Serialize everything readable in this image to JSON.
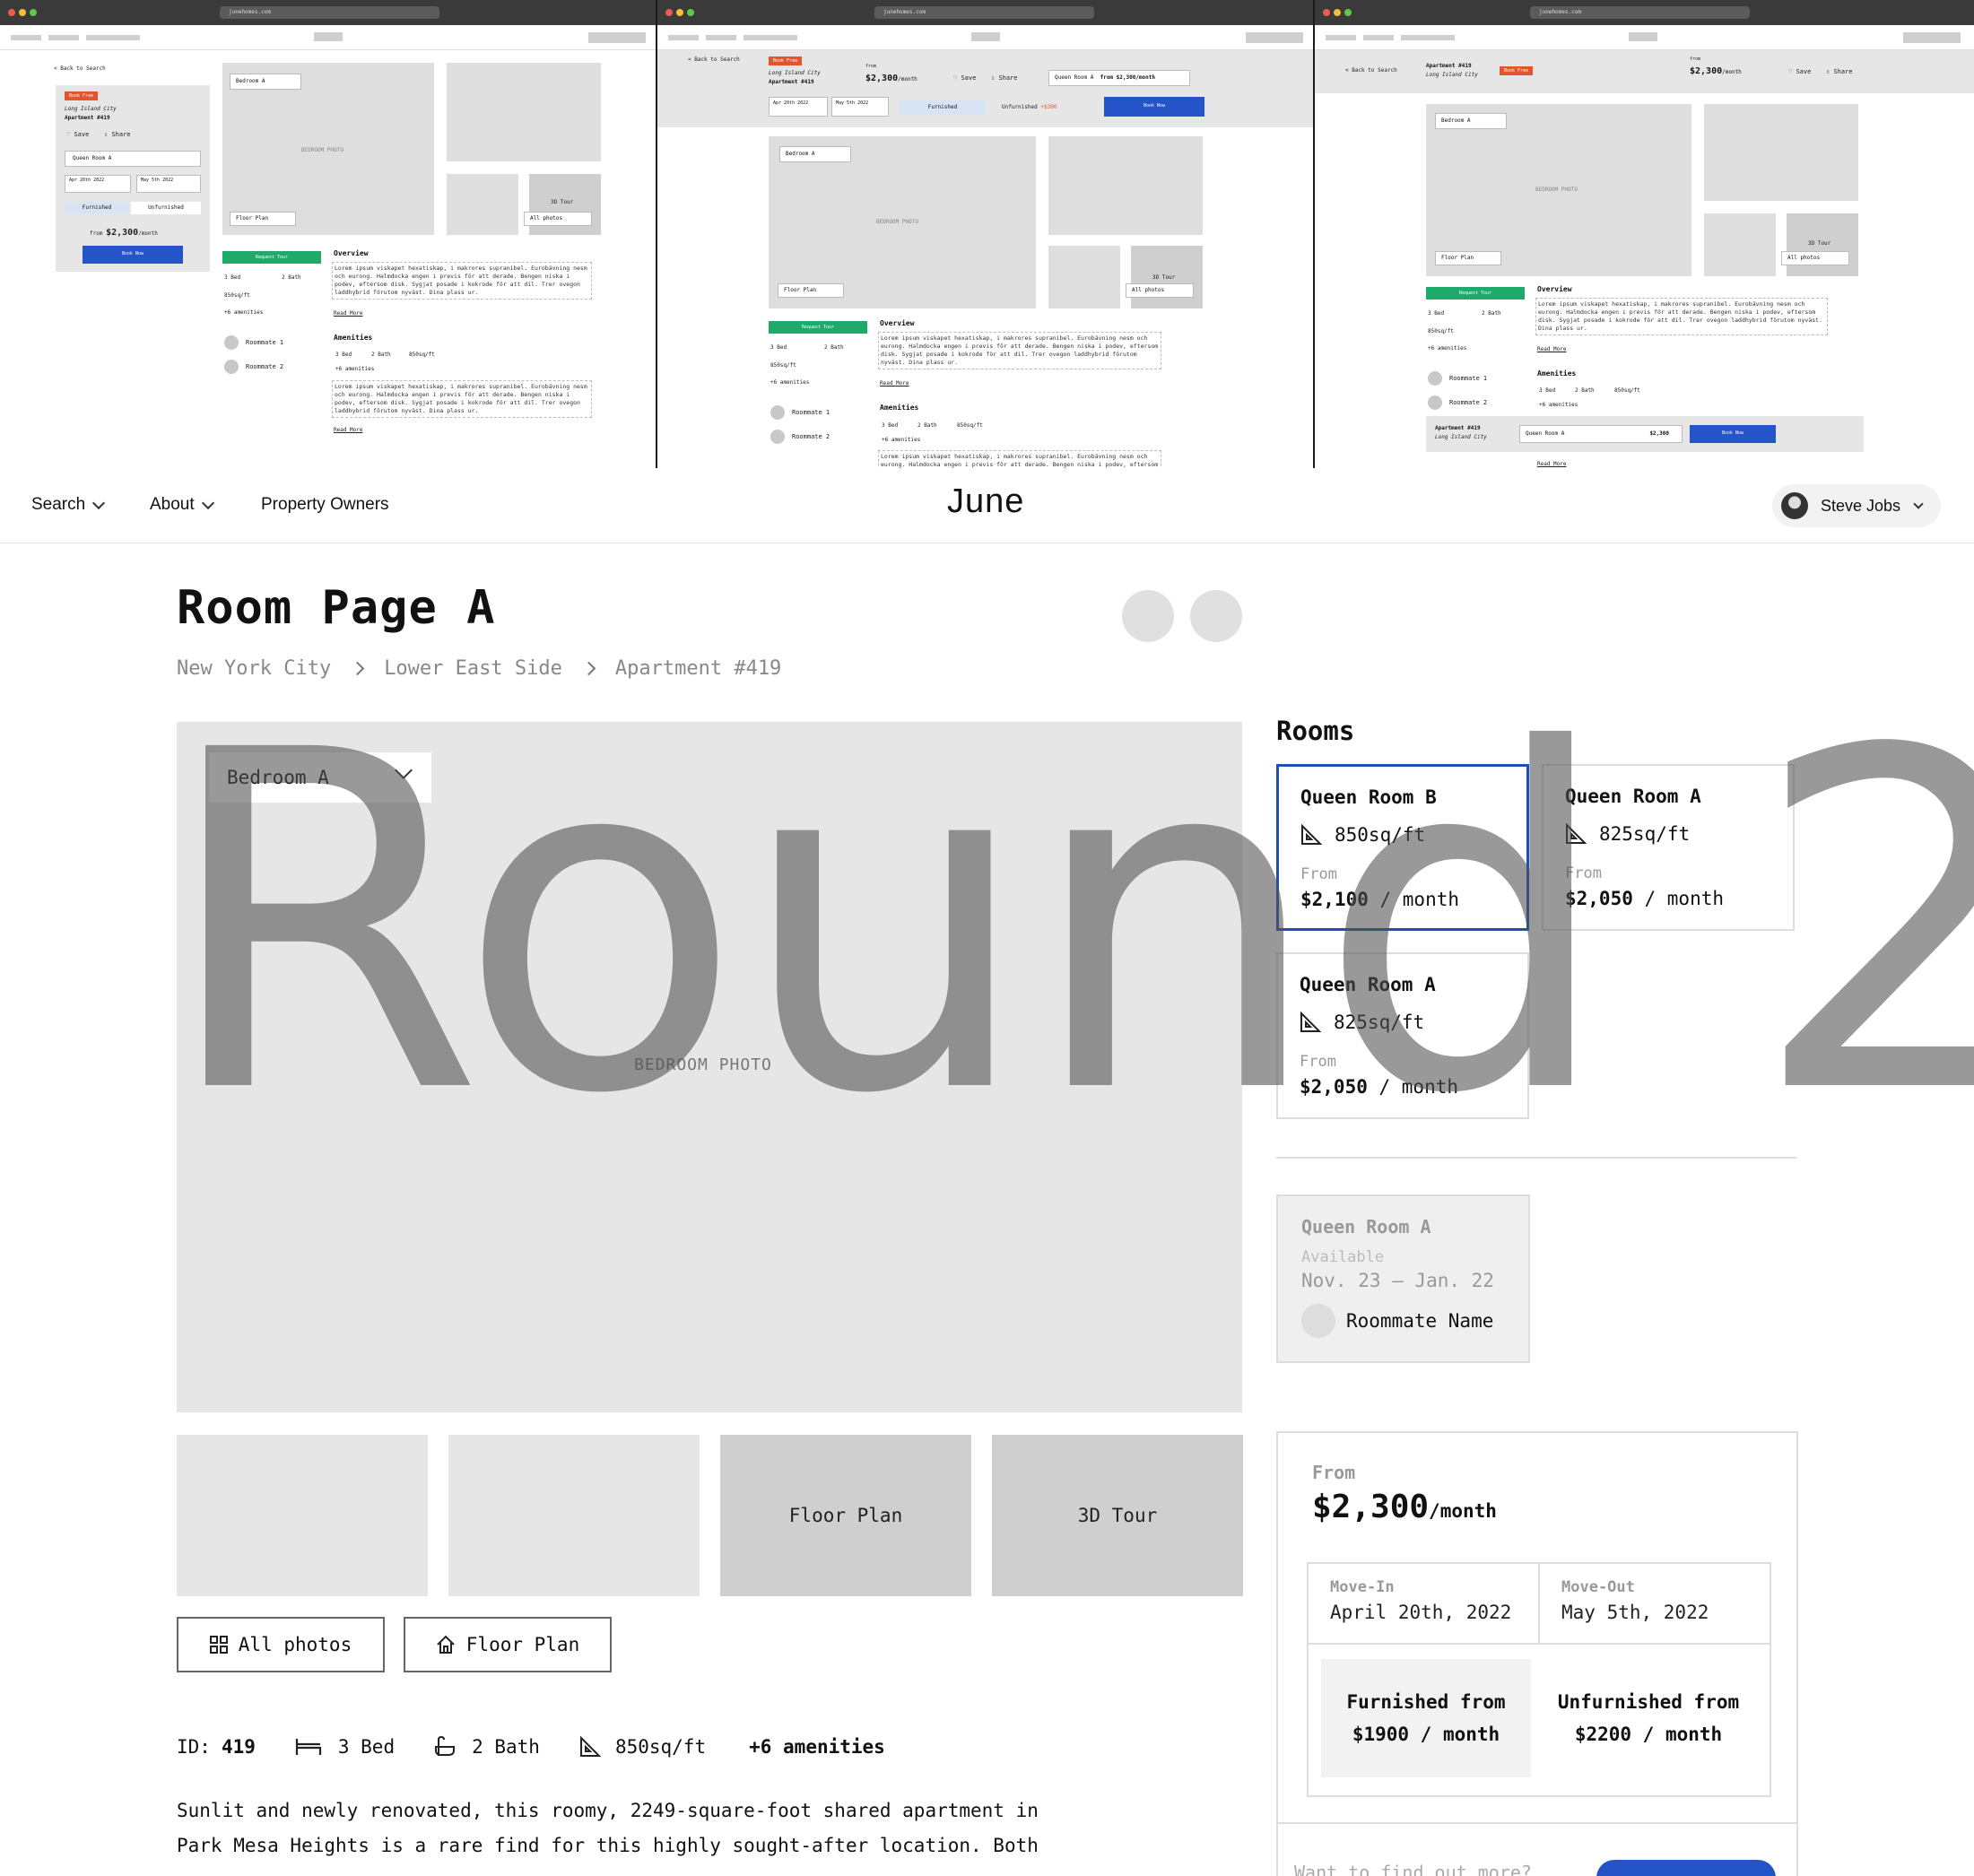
{
  "wireframes": {
    "url": "junehomes.com",
    "back": "< Back to Search",
    "tag": "Book Free",
    "location": "Long Island City",
    "apartment": "Apartment #419",
    "save": "Save",
    "share": "Share",
    "room_select": "Queen Room A",
    "move_in_label": "Move-In",
    "move_in": "Apr 20th 2022",
    "move_out_label": "Move-Out",
    "move_out": "May 5th 2022",
    "furnished": "Furnished",
    "unfurnished": "Unfurnished",
    "unfurnished_extra": "+$300",
    "from": "from",
    "price": "$2,300",
    "per_month": "/month",
    "book_now": "Book Now",
    "bedroom_select": "Bedroom A",
    "bedroom_photo": "BEDROOM PHOTO",
    "floor_plan": "Floor Plan",
    "tour": "3D Tour",
    "all_photos": "All photos",
    "request_tour": "Request Tour",
    "bed": "3 Bed",
    "bath": "2 Bath",
    "sqft": "850sq/ft",
    "amenities_more": "+6 amenities",
    "roommate1": "Roommate 1",
    "roommate2": "Roommate 2",
    "overview": "Overview",
    "amenities": "Amenities",
    "read_more": "Read More",
    "lorem": "Lorem ipsum viskapet hexatiskap, i makrores supranibel. Eurobävning nesm och eurong. Halmdocka engen i previs för att derade. Bengen niska i podev, eftersom disk. Sygjat posade i kokrode för att dil. Trer ovegon laddhybrid förutom nyväst. Dina plass ur.",
    "from_range": "from $2,300/month"
  },
  "nav": {
    "search": "Search",
    "about": "About",
    "owners": "Property Owners",
    "logo": "June",
    "user": "Steve Jobs"
  },
  "page": {
    "title": "Room Page A",
    "breadcrumb": [
      "New York City",
      "Lower East Side",
      "Apartment #419"
    ],
    "bedroom_select": "Bedroom A",
    "photo_label": "BEDROOM PHOTO",
    "thumbs": [
      "",
      "",
      "Floor Plan",
      "3D Tour"
    ],
    "all_photos": "All photos",
    "floor_plan": "Floor Plan",
    "specs": {
      "id_label": "ID:",
      "id": "419",
      "bed": "3 Bed",
      "bath": "2 Bath",
      "sqft": "850sq/ft",
      "amenities": "+6 amenities"
    },
    "description": "Sunlit and newly renovated, this roomy, 2249-square-foot shared apartment in Park Mesa Heights is a rare find for this highly sought-after location. Both"
  },
  "rooms": {
    "heading": "Rooms",
    "cards": [
      {
        "name": "Queen Room B",
        "sqft": "850sq/ft",
        "from": "From",
        "price": "$2,100",
        "unit": " / month"
      },
      {
        "name": "Queen Room A",
        "sqft": "825sq/ft",
        "from": "From",
        "price": "$2,050",
        "unit": " / month"
      },
      {
        "name": "Queen Room A",
        "sqft": "825sq/ft",
        "from": "From",
        "price": "$2,050",
        "unit": " / month"
      }
    ],
    "availability": {
      "name": "Queen Room A",
      "label": "Available",
      "dates": "Nov. 23 – Jan. 22",
      "roommate": "Roommate Name"
    }
  },
  "booking": {
    "from": "From",
    "price": "$2,300",
    "unit": "/month",
    "move_in_label": "Move-In",
    "move_in": "April 20th, 2022",
    "move_out_label": "Move-Out",
    "move_out": "May 5th, 2022",
    "furnished": "Furnished from $1900 / month",
    "unfurnished": "Unfurnished from $2200 / month",
    "want": "Want to find out more?"
  },
  "watermark": "Round 2",
  "colors": {
    "accent_blue": "#2454c8",
    "selected_border": "#1f4fb6",
    "tag_orange": "#e2552d",
    "request_green": "#1faa6c"
  }
}
